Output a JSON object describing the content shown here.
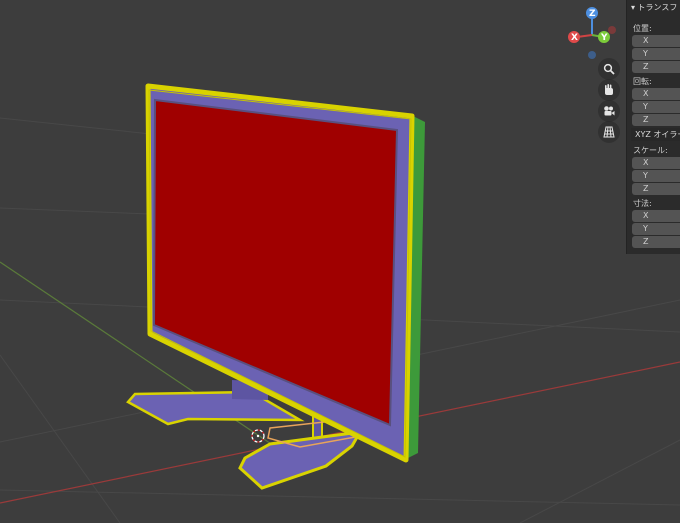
{
  "gizmo": {
    "z_label": "Z",
    "x_label": "X",
    "y_label": "Y"
  },
  "nav_icons": [
    "zoom-icon",
    "hand-pan-icon",
    "camera-icon",
    "grid-view-icon"
  ],
  "panel": {
    "title": "▾  トランスフ",
    "location": {
      "label": "位置:",
      "x": "X",
      "y": "Y",
      "z": "Z"
    },
    "rotation": {
      "label": "回転:",
      "x": "X",
      "y": "Y",
      "z": "Z"
    },
    "rotation_mode": "XYZ オイラー",
    "scale": {
      "label": "スケール:",
      "x": "X",
      "y": "Y",
      "z": "Z"
    },
    "dimensions": {
      "label": "寸法:",
      "x": "X",
      "y": "Y",
      "z": "Z"
    }
  },
  "colors": {
    "background": "#3d3d3d",
    "screen": "#a00000",
    "bezel": "#6b62b3",
    "edge_yellow": "#d9d300",
    "edge_green": "#3d9a3a",
    "axis_red": "#9a3a3a",
    "axis_green": "#5a7a3a"
  }
}
